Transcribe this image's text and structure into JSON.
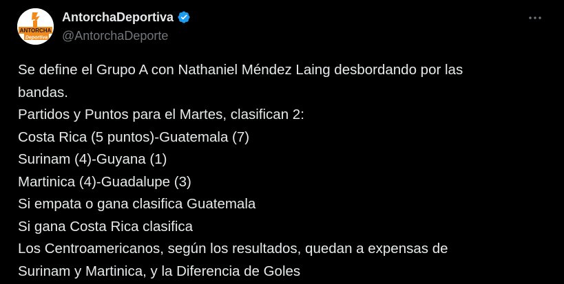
{
  "tweet": {
    "author": {
      "display_name": "AntorchaDeportiva",
      "handle": "@AntorchaDeporte",
      "avatar_text_top": "ANTORCHA",
      "avatar_text_bottom": "Deportiva",
      "verified": true,
      "verified_color": "#1d9bf0",
      "avatar_brand_color": "#f08a1c",
      "avatar_icon": "torch-logo-icon",
      "verified_icon": "verified-badge-icon"
    },
    "more_icon": "more-options-icon",
    "text_lines": [
      "Se define el Grupo A con Nathaniel Méndez Laing desbordando por las",
      "bandas.",
      "Partidos y Puntos para el Martes, clasifican 2:",
      "Costa Rica (5 puntos)-Guatemala (7)",
      "Surinam (4)-Guyana (1)",
      "Martinica (4)-Guadalupe (3)",
      "Si empata o gana clasifica Guatemala",
      "Si gana Costa Rica clasifica",
      "Los Centroamericanos, según los resultados, quedan a expensas de",
      "Surinam y Martinica, y la Diferencia de Goles"
    ]
  },
  "theme": {
    "background": "#000000",
    "text_primary": "#e7e9ea",
    "text_secondary": "#71767b"
  }
}
